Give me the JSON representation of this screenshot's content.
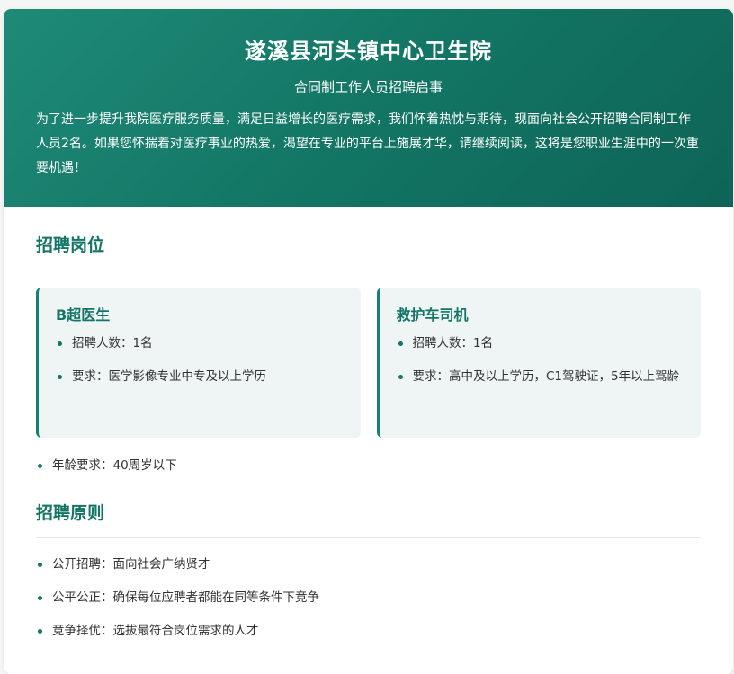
{
  "header": {
    "title": "遂溪县河头镇中心卫生院",
    "subtitle": "合同制工作人员招聘启事",
    "intro": "为了进一步提升我院医疗服务质量，满足日益增长的医疗需求，我们怀着热忱与期待，现面向社会公开招聘合同制工作人员2名。如果您怀揣着对医疗事业的热爱，渴望在专业的平台上施展才华，请继续阅读，这将是您职业生涯中的一次重要机遇！"
  },
  "positions_section": {
    "title": "招聘岗位",
    "cards": [
      {
        "title": "B超医生",
        "items": [
          "招聘人数：1名",
          "要求：医学影像专业中专及以上学历"
        ]
      },
      {
        "title": "救护车司机",
        "items": [
          "招聘人数：1名",
          "要求：高中及以上学历，C1驾驶证，5年以上驾龄"
        ]
      }
    ],
    "age_requirement": "年龄要求：40周岁以下"
  },
  "principles_section": {
    "title": "招聘原则",
    "items": [
      "公开招聘：面向社会广纳贤才",
      "公平公正：确保每位应聘者都能在同等条件下竞争",
      "竞争择优：选拔最符合岗位需求的人才"
    ]
  },
  "colors": {
    "header_gradient_start": "#1f8a78",
    "header_gradient_end": "#0e6456",
    "accent": "#137566",
    "card_background": "#eef5f4"
  }
}
